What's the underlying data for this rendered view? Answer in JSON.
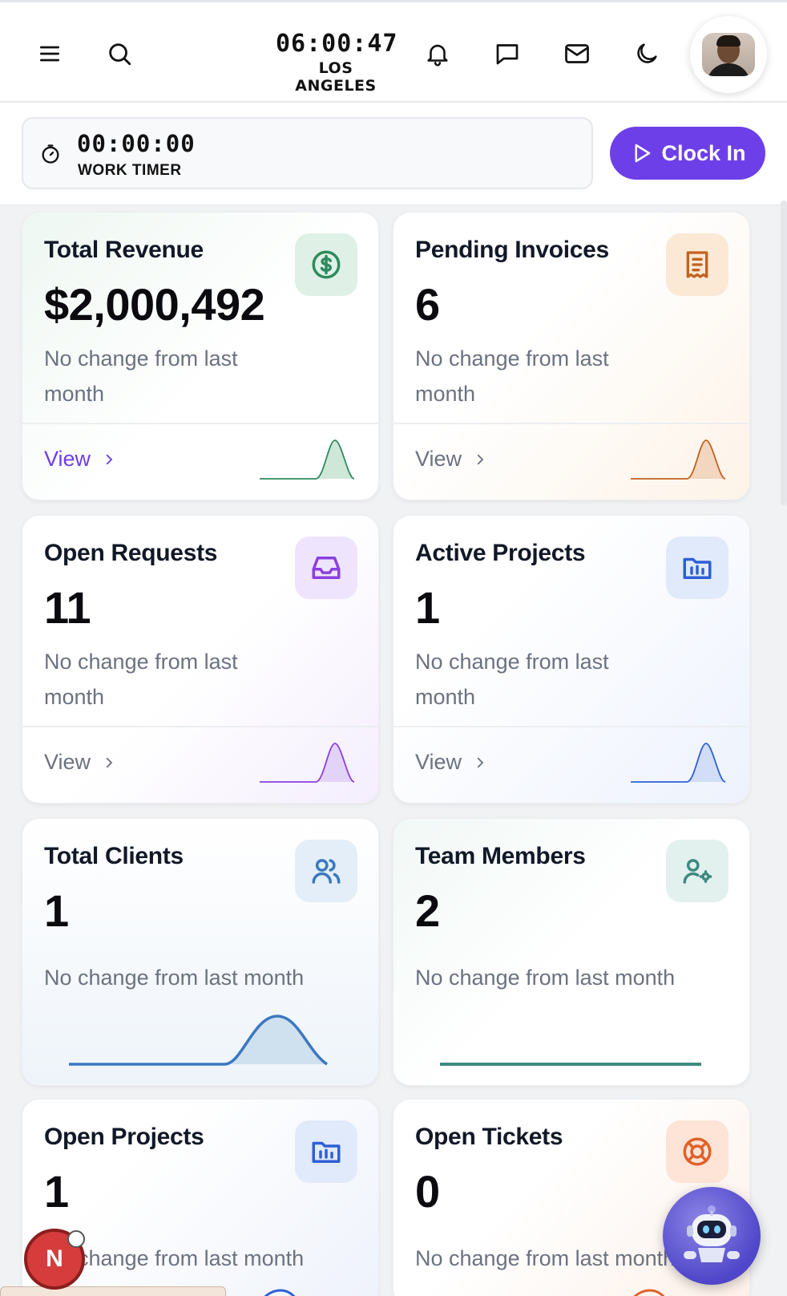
{
  "header": {
    "clock_time": "06:00:47",
    "clock_city": "LOS ANGELES"
  },
  "timer": {
    "time": "00:00:00",
    "label": "WORK TIMER",
    "clock_in_label": "Clock In"
  },
  "colors": {
    "accent": "#6d3fe8",
    "green": "#2f8a5f",
    "orange": "#c2621d",
    "purple": "#8b3fe0",
    "blue": "#2f5fd6",
    "steel": "#3b78bf",
    "teal": "#3f8a80"
  },
  "cards": [
    {
      "title": "Total Revenue",
      "value": "$2,000,492",
      "subtitle": "No change from last month",
      "link": "View",
      "icon": "dollar-icon"
    },
    {
      "title": "Pending Invoices",
      "value": "6",
      "subtitle": "No change from last month",
      "link": "View",
      "icon": "receipt-icon"
    },
    {
      "title": "Open Requests",
      "value": "11",
      "subtitle": "No change from last month",
      "link": "View",
      "icon": "inbox-icon"
    },
    {
      "title": "Active Projects",
      "value": "1",
      "subtitle": "No change from last month",
      "link": "View",
      "icon": "folder-chart-icon"
    },
    {
      "title": "Total Clients",
      "value": "1",
      "subtitle": "No change from last month",
      "icon": "users-icon"
    },
    {
      "title": "Team Members",
      "value": "2",
      "subtitle": "No change from last month",
      "icon": "user-gear-icon"
    },
    {
      "title": "Open Projects",
      "value": "1",
      "subtitle": "No change from last month",
      "icon": "folder-chart-icon"
    },
    {
      "title": "Open Tickets",
      "value": "0",
      "subtitle": "No change from last month",
      "icon": "lifebuoy-icon"
    }
  ],
  "floating": {
    "notification_initial": "N"
  }
}
